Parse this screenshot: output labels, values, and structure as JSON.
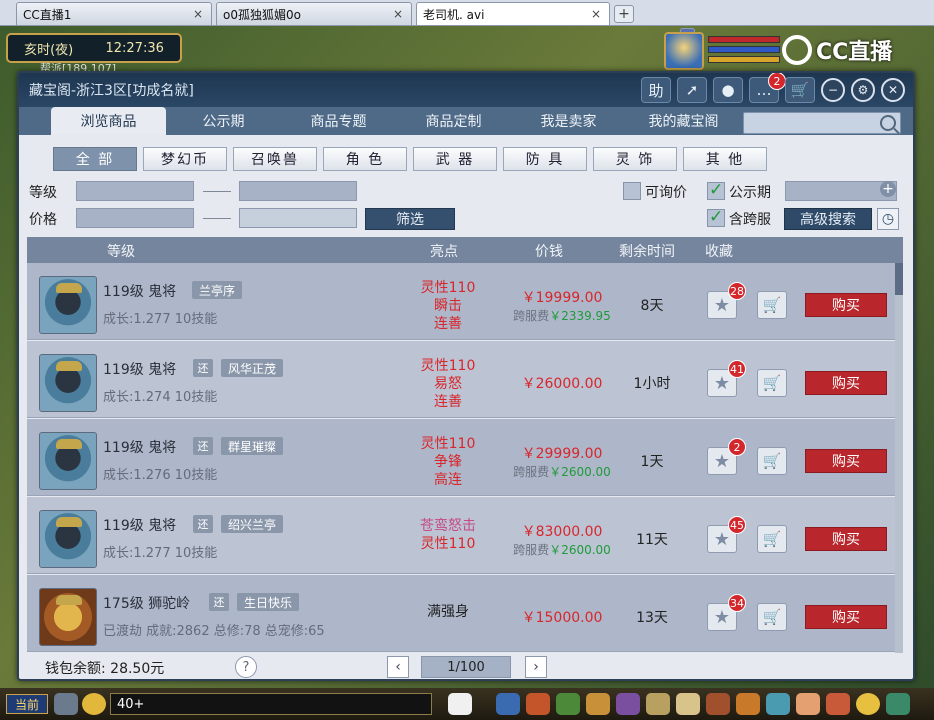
{
  "browser_tabs": [
    {
      "title": "CC直播1",
      "close": "×"
    },
    {
      "title": "o0孤独狐媚0o",
      "close": "×"
    },
    {
      "title": "老司机. avi",
      "close": "×"
    }
  ],
  "new_tab": "+",
  "hud": {
    "time_period": "亥时(夜)",
    "clock": "12:27:36",
    "coords": "帮派[189,107]",
    "watermark": "CC直播"
  },
  "panel": {
    "title": "藏宝阁-浙江3区[功成名就]",
    "title_icons": {
      "help": "助",
      "share": "➚",
      "record": "●",
      "message": "…",
      "message_badge": "2",
      "cart": "🛒",
      "minimize": "−",
      "settings": "⚙",
      "close": "✕"
    },
    "nav_tabs": [
      "浏览商品",
      "公示期",
      "商品专题",
      "商品定制",
      "我是卖家",
      "我的藏宝阁"
    ],
    "search": {
      "value": "",
      "placeholder": ""
    },
    "categories": [
      "全 部",
      "梦幻币",
      "召唤兽",
      "角 色",
      "武 器",
      "防 具",
      "灵 饰",
      "其 他"
    ],
    "filters": {
      "level_label": "等级",
      "price_label": "价格",
      "filter_button": "筛选",
      "inquiry_label": "可询价",
      "public_label": "公示期",
      "cross_server_label": "含跨服",
      "advanced_button": "高级搜索"
    },
    "table_headers": {
      "level": "等级",
      "highlight": "亮点",
      "price": "价钱",
      "time_left": "剩余时间",
      "favorite": "收藏"
    },
    "rows": [
      {
        "level": "119级",
        "name": "鬼将",
        "huan": "",
        "tag": "兰亭序",
        "sub": "成长:1.277  10技能",
        "highlights": [
          "灵性110",
          "瞬击",
          "连善"
        ],
        "price": "￥19999.00",
        "fee_label": "跨服费",
        "fee": "￥2339.95",
        "time": "8天",
        "fav_count": "28",
        "buy": "购买"
      },
      {
        "level": "119级",
        "name": "鬼将",
        "huan": "还",
        "tag": "风华正茂",
        "sub": "成长:1.274  10技能",
        "highlights": [
          "灵性110",
          "易怒",
          "连善"
        ],
        "price": "￥26000.00",
        "fee_label": "",
        "fee": "",
        "time": "1小时",
        "fav_count": "41",
        "buy": "购买"
      },
      {
        "level": "119级",
        "name": "鬼将",
        "huan": "还",
        "tag": "群星璀璨",
        "sub": "成长:1.276  10技能",
        "highlights": [
          "灵性110",
          "争锋",
          "高连"
        ],
        "price": "￥29999.00",
        "fee_label": "跨服费",
        "fee": "￥2600.00",
        "time": "1天",
        "fav_count": "2",
        "buy": "购买"
      },
      {
        "level": "119级",
        "name": "鬼将",
        "huan": "还",
        "tag": "绍兴兰亭",
        "sub": "成长:1.277  10技能",
        "highlights": [
          "苍鸾怒击",
          "灵性110"
        ],
        "price": "￥83000.00",
        "fee_label": "跨服费",
        "fee": "￥2600.00",
        "time": "11天",
        "fav_count": "45",
        "buy": "购买"
      },
      {
        "level": "175级",
        "name": "狮驼岭",
        "huan": "还",
        "tag": "生日快乐",
        "sub": "已渡劫 成就:2862 总修:78 总宠修:65",
        "highlights": [
          "满强身"
        ],
        "price": "￥15000.00",
        "fee_label": "",
        "fee": "",
        "time": "13天",
        "fav_count": "34",
        "buy": "购买"
      }
    ],
    "wallet": "钱包余额: 28.50元",
    "help": "?",
    "prev": "‹",
    "next": "›",
    "page": "1/100"
  },
  "bottom": {
    "now": "当前",
    "chat_input": "40+"
  }
}
